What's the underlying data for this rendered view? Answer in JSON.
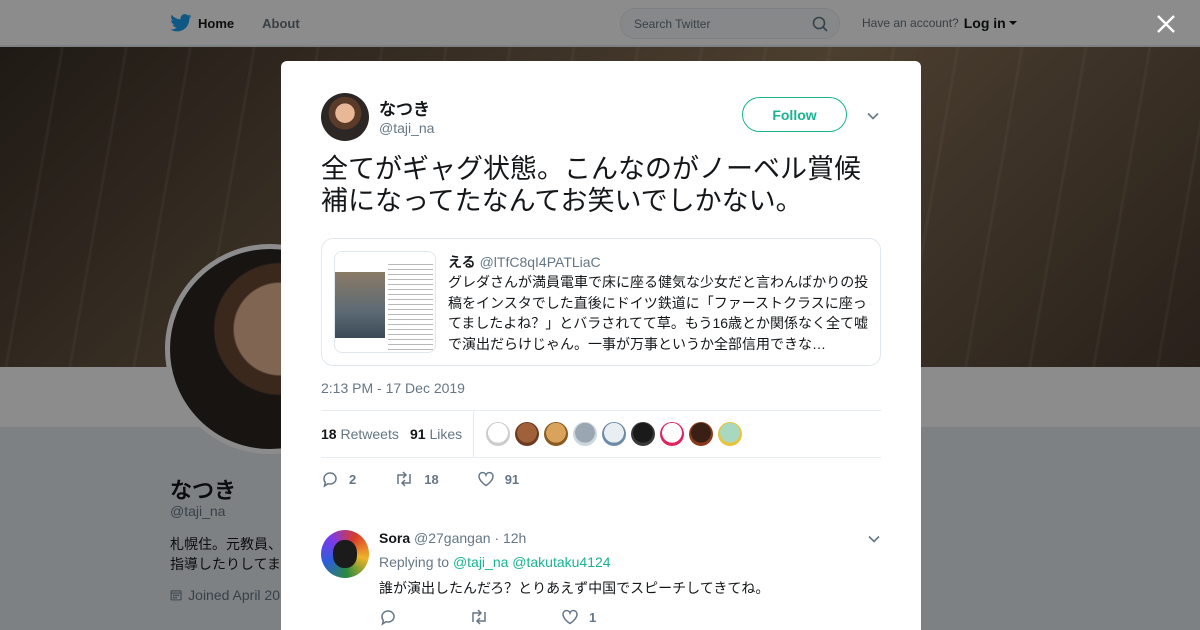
{
  "nav": {
    "home": "Home",
    "about": "About",
    "search_placeholder": "Search Twitter",
    "account_prompt": "Have an account?",
    "login": "Log in"
  },
  "profile_bg": {
    "name": "なつき",
    "handle": "@taji_na",
    "bio_line1": "札幌住。元教員、",
    "bio_line2": "指導したりしてま",
    "joined": "Joined April 20"
  },
  "tweet": {
    "author_name": "なつき",
    "author_handle": "@taji_na",
    "follow_label": "Follow",
    "text": "全てがギャグ状態。こんなのがノーベル賞候補になってたなんてお笑いでしかない。",
    "timestamp": "2:13 PM - 17 Dec 2019",
    "retweets_count": "18",
    "retweets_label": "Retweets",
    "likes_count": "91",
    "likes_label": "Likes",
    "action_reply_count": "2",
    "action_retweet_count": "18",
    "action_like_count": "91"
  },
  "quote": {
    "name": "える",
    "handle": "@lTfC8qI4PATLiaC",
    "text": "グレダさんが満員電車で床に座る健気な少女だと言わんばかりの投稿をインスタでした直後にドイツ鉄道に「ファーストクラスに座ってましたよね？」とバラされてて草。もう16歳とか関係なく全て嘘で演出だらけじゃん。一事が万事というか全部信用できな…"
  },
  "likers": [
    {
      "color": "#ffffff",
      "ring": "#cccccc"
    },
    {
      "color": "#a0603a",
      "ring": "#6b3a20"
    },
    {
      "color": "#d9a35b",
      "ring": "#8a5a22"
    },
    {
      "color": "#9aa6b2",
      "ring": "#ccd6dd"
    },
    {
      "color": "#e9eef2",
      "ring": "#6f8ba8"
    },
    {
      "color": "#1a1a1a",
      "ring": "#3a3a3a"
    },
    {
      "color": "#ffffff",
      "ring": "#e0245e"
    },
    {
      "color": "#3a1f14",
      "ring": "#8a3a1a"
    },
    {
      "color": "#a8d8c0",
      "ring": "#e8c43a"
    }
  ],
  "reply": {
    "name": "Sora",
    "handle": "@27gangan",
    "time": "· 12h",
    "replying_to_label": "Replying to",
    "mention1": "@taji_na",
    "mention2": "@takutaku4124",
    "text": "誰が演出したんだろ？とりあえず中国でスピーチしてきてね。",
    "like_count": "1"
  },
  "colors": {
    "accent": "#19b393",
    "twitter_blue": "#1da1f2",
    "text_primary": "#14171a",
    "text_secondary": "#657786"
  }
}
